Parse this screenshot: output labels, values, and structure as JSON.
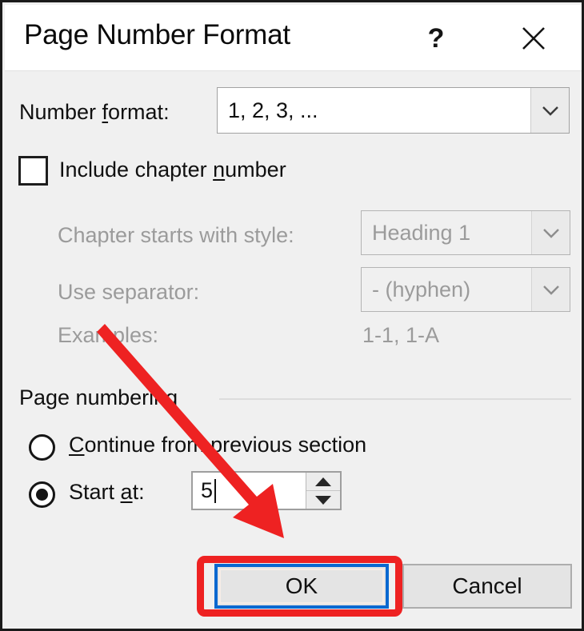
{
  "dialog": {
    "title": "Page Number Format",
    "help_icon": "?",
    "close_icon": "close-x"
  },
  "number_format": {
    "label_prefix": "Number ",
    "label_accel": "f",
    "label_suffix": "ormat:",
    "value": "1, 2, 3, ...",
    "dropdown_icon": "chevron-down-icon"
  },
  "include_chapter": {
    "label_prefix": "Include chapter ",
    "label_accel": "n",
    "label_suffix": "umber",
    "checked": false
  },
  "chapter_style": {
    "label": "Chapter starts with style:",
    "value": "Heading 1",
    "enabled": false,
    "dropdown_icon": "chevron-down-icon"
  },
  "separator": {
    "label": "Use separator:",
    "value": "-   (hyphen)",
    "enabled": false,
    "dropdown_icon": "chevron-down-icon"
  },
  "examples": {
    "label": "Examples:",
    "value": "1-1, 1-A"
  },
  "page_numbering": {
    "group_label": "Page numbering",
    "continue_option": {
      "label_prefix": "",
      "label_accel": "C",
      "label_suffix": "ontinue from previous section",
      "selected": false
    },
    "start_at_option": {
      "label_prefix": "Start ",
      "label_accel": "a",
      "label_suffix": "t:",
      "selected": true,
      "value": "5",
      "spin_up_icon": "triangle-up-icon",
      "spin_down_icon": "triangle-down-icon"
    }
  },
  "footer": {
    "ok_label": "OK",
    "cancel_label": "Cancel"
  },
  "annotations": {
    "highlight_color": "#ee2222",
    "arrow_color": "#ee2222",
    "arrow_name": "red-pointer-arrow",
    "highlight_target": "ok-button"
  }
}
